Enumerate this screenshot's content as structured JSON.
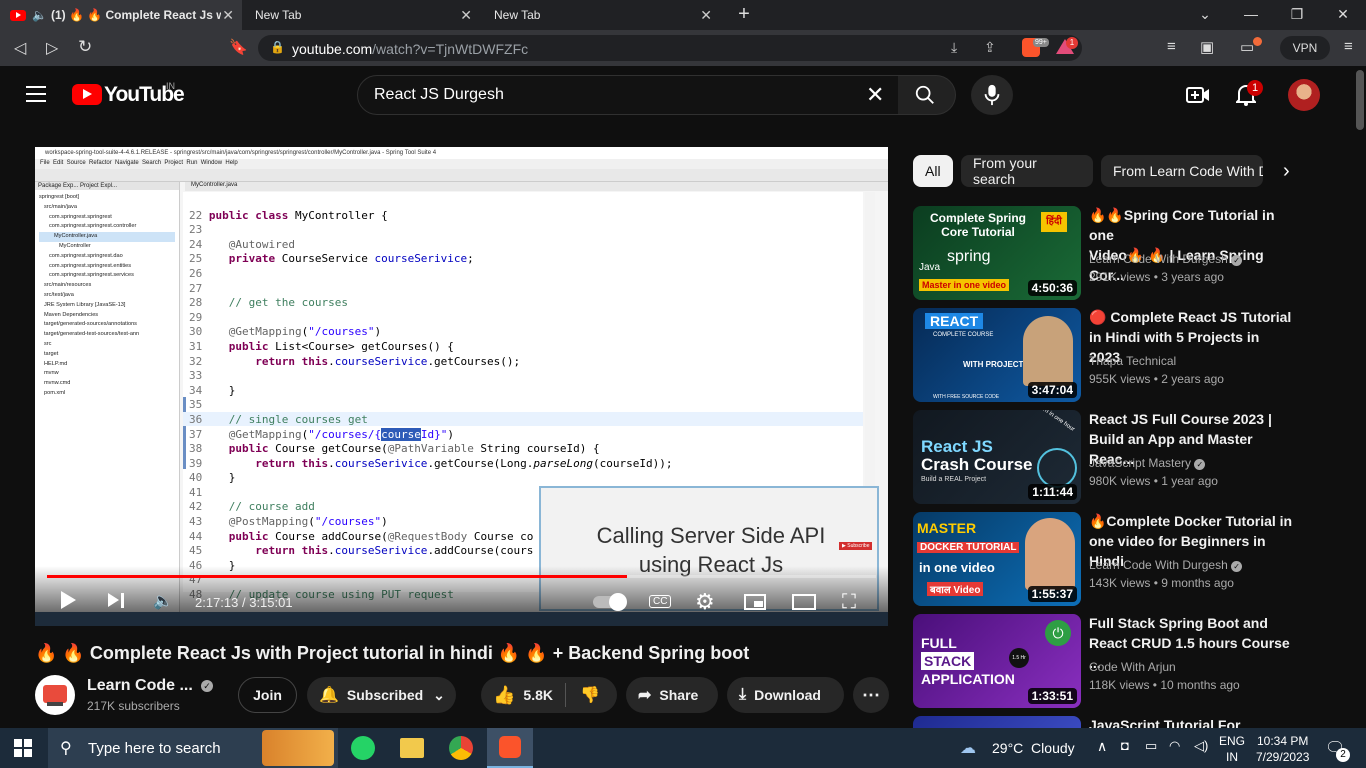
{
  "browser": {
    "tabs": [
      {
        "label": "(1) 🔥 🔥 Complete React Js wi",
        "active": true
      },
      {
        "label": "New Tab",
        "active": false
      },
      {
        "label": "New Tab",
        "active": false
      }
    ],
    "url_host": "youtube.com",
    "url_path": "/watch?v=TjnWtDWFZFc",
    "brave_badge": "99+",
    "alert_badge": "1",
    "vpn_label": "VPN"
  },
  "header": {
    "logo_text": "YouTube",
    "region": "IN",
    "search_value": "React JS Durgesh",
    "notif_count": "1"
  },
  "player": {
    "ide_title": "workspace-spring-tool-suite-4-4.6.1.RELEASE - springrest/src/main/java/com/springrest/springrest/controller/MyController.java - Spring Tool Suite 4",
    "ide_menu": "File  Edit  Source  Refactor  Navigate  Search  Project  Run  Window  Help",
    "ide_tab": "MyController.java",
    "overlay_text_1": "Calling Server Side API",
    "overlay_text_2": "using React Js",
    "time_current": "2:17:13",
    "time_total": "3:15:01",
    "progress": 0.7,
    "tree": [
      "springrest [boot]",
      "src/main/java",
      "com.springrest.springrest",
      "com.springrest.springrest.controller",
      "MyController.java",
      "MyController",
      "com.springrest.springrest.dao",
      "com.springrest.springrest.entities",
      "com.springrest.springrest.services",
      "src/main/resources",
      "src/test/java",
      "JRE System Library [JavaSE-13]",
      "Maven Dependencies",
      "target/generated-sources/annotations",
      "target/generated-test-sources/test-ann",
      "src",
      "target",
      "HELP.md",
      "mvnw",
      "mvnw.cmd",
      "pom.xml"
    ]
  },
  "video": {
    "title": "🔥 🔥 Complete React Js with Project tutorial in hindi 🔥 🔥 + Backend Spring boot",
    "channel": "Learn Code ...",
    "subscribers": "217K subscribers",
    "join_label": "Join",
    "subscribed_label": "Subscribed",
    "likes": "5.8K",
    "share_label": "Share",
    "download_label": "Download"
  },
  "chips": [
    "All",
    "From your search",
    "From Learn Code With D"
  ],
  "recommendations": [
    {
      "title_1": "🔥🔥Spring Core Tutorial in one",
      "title_2": "Video🔥 🔥 | Learn Spring Cor...",
      "channel": "Learn Code With Durgesh",
      "meta": "291K views • 3 years ago",
      "duration": "4:50:36",
      "thumb_text_1": "Complete Spring",
      "thumb_text_2": "Core Tutorial",
      "thumb_text_3": "Master in one video",
      "thumb_text_4": "spring",
      "thumb_text_5": "हिंदी",
      "thumb_text_6": "Java",
      "bg": "#0b3d20"
    },
    {
      "title_1": "🔴 Complete React JS Tutorial",
      "title_2": "in Hindi with 5 Projects in 2023",
      "channel": "Thapa Technical",
      "meta": "955K views • 2 years ago",
      "duration": "3:47:04",
      "thumb_text_1": "REACT",
      "thumb_text_2": "COMPLETE COURSE",
      "thumb_text_3": "WITH PROJECT 5",
      "thumb_text_4": "WITH FREE SOURCE CODE",
      "bg": "#0a3a6b"
    },
    {
      "title_1": "React JS Full Course 2023 |",
      "title_2": "Build an App and Master Reac...",
      "channel": "JavaScript Mastery",
      "meta": "980K views • 1 year ago",
      "duration": "1:11:44",
      "thumb_text_1": "React JS",
      "thumb_text_2": "Crash Course",
      "thumb_text_3": "Build a REAL Project",
      "thumb_text_4": "Learn in one hour",
      "bg": "#101820"
    },
    {
      "title_1": "🔥Complete Docker Tutorial in",
      "title_2": "one video for Beginners in Hindi",
      "channel": "Learn Code With Durgesh",
      "meta": "143K views • 9 months ago",
      "duration": "1:55:37",
      "thumb_text_1": "MASTER",
      "thumb_text_2": "DOCKER TUTORIAL",
      "thumb_text_3": "in one video",
      "thumb_text_4": "बवाल Video",
      "bg": "#0c4a7a"
    },
    {
      "title_1": "Full Stack Spring Boot and",
      "title_2": "React CRUD 1.5 hours Course ...",
      "channel": "Code With Arjun",
      "meta": "118K views • 10 months ago",
      "duration": "1:33:51",
      "thumb_text_1": "FULL",
      "thumb_text_2": "STACK",
      "thumb_text_3": "APPLICATION",
      "thumb_text_4": "1.5 Hr",
      "bg": "#6a1a9a"
    },
    {
      "title_1": "JavaScript Tutorial For",
      "bg": "#2a3aa0"
    }
  ],
  "taskbar": {
    "search_placeholder": "Type here to search",
    "weather": "29°C  Cloudy",
    "lang_1": "ENG",
    "lang_2": "IN",
    "time": "10:34 PM",
    "date": "7/29/2023",
    "notif": "2"
  },
  "colors": {
    "yt_red": "#ff0000",
    "bg": "#0f0f0f",
    "chip": "#272727",
    "taskbar": "#1c2b3a"
  }
}
